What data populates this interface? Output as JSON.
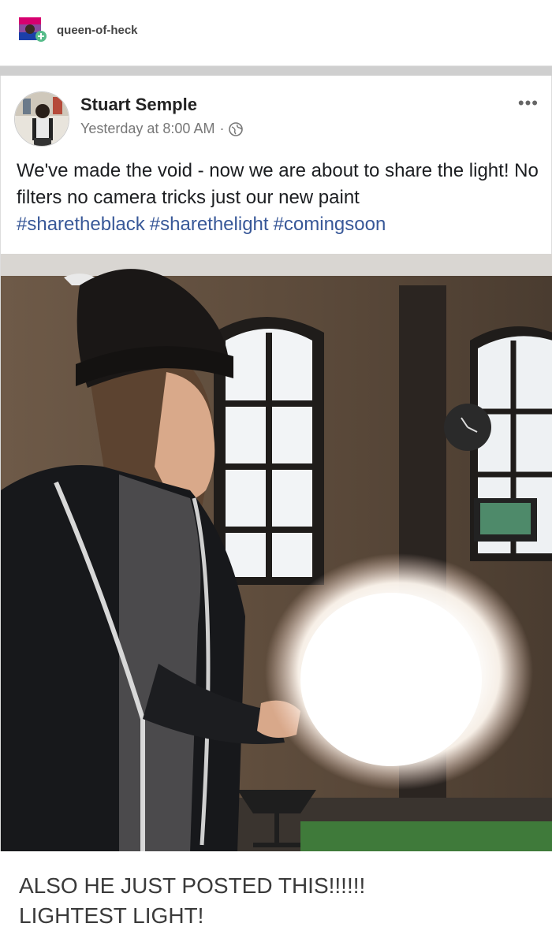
{
  "reblog": {
    "username": "queen-of-heck"
  },
  "post": {
    "author": "Stuart Semple",
    "timestamp": "Yesterday at 8:00 AM",
    "separator_dot": "·",
    "more_label": "•••",
    "text": "We've made the void - now we are about to share the light! No filters no camera tricks just our new paint",
    "hashtags": [
      "#sharetheblack",
      "#sharethelight",
      "#comingsoon"
    ]
  },
  "caption": {
    "line1": "ALSO HE JUST POSTED THIS!!!!!!",
    "line2": "LIGHTEST LIGHT!"
  },
  "colors": {
    "link": "#385898",
    "separator": "#cfcfcf"
  }
}
